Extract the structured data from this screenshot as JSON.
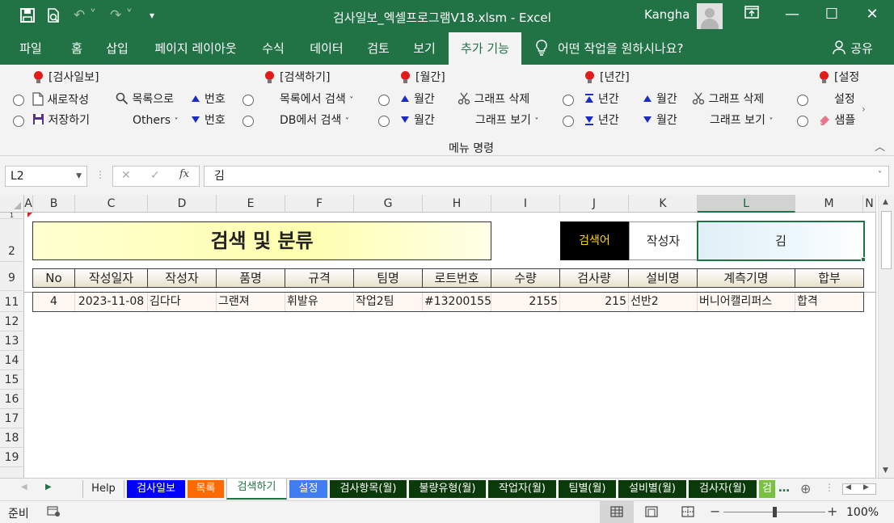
{
  "titlebar": {
    "doc_title": "검사일보_엑셀프로그램V18.xlsm  -  Excel",
    "user": "Kangha",
    "customize_glyph": "▾"
  },
  "ribbon_tabs": [
    {
      "label": "파일"
    },
    {
      "label": "홈"
    },
    {
      "label": "삽입"
    },
    {
      "label": "페이지 레이아웃"
    },
    {
      "label": "수식"
    },
    {
      "label": "데이터"
    },
    {
      "label": "검토"
    },
    {
      "label": "보기"
    },
    {
      "label": "추가 기능"
    }
  ],
  "tell_me": "어떤 작업을 원하시나요?",
  "share": "공유",
  "ribbon": {
    "groups": {
      "daily": "[검사일보]",
      "search": "[검색하기]",
      "monthly": "[월간]",
      "yearly": "[년간]",
      "settings": "[설정"
    },
    "new_doc": "새로작성",
    "save": "저장하기",
    "to_list": "목록으로",
    "others": "Others",
    "num_up": "번호",
    "num_down": "번호",
    "search_list": "목록에서 검색",
    "search_db": "DB에서 검색",
    "month_up": "월간",
    "month_down": "월간",
    "graph_delete": "그래프 삭제",
    "graph_view": "그래프 보기",
    "year_up": "년간",
    "year_down": "년간",
    "month2_up": "월간",
    "month2_down": "월간",
    "graph2_delete": "그래프 삭제",
    "graph2_view": "그래프 보기",
    "settings_btn": "설정",
    "sample_btn": "샘플",
    "group_caption": "메뉴 명령"
  },
  "formula": {
    "cell_ref": "L2",
    "value": "김"
  },
  "columns": [
    "A",
    "B",
    "C",
    "D",
    "E",
    "F",
    "G",
    "H",
    "I",
    "J",
    "K",
    "L",
    "M",
    "N"
  ],
  "sheet": {
    "title": "검색 및 분류",
    "search_label": "검색어",
    "search_field": "작성자",
    "search_value": "김",
    "headers": [
      "No",
      "작성일자",
      "작성자",
      "품명",
      "규격",
      "팀명",
      "로트번호",
      "수량",
      "검사량",
      "설비명",
      "계측기명",
      "합부"
    ],
    "row": [
      "4",
      "2023-11-08",
      "김다다",
      "그랜져",
      "휘발유",
      "작업2팀",
      "#13200155",
      "2155",
      "215",
      "선반2",
      "버니어캘리퍼스",
      "합격"
    ]
  },
  "row_numbers": [
    "1",
    "2",
    "9",
    "11",
    "12",
    "13",
    "14",
    "15",
    "16",
    "17",
    "18",
    "19"
  ],
  "sheet_tabs": [
    {
      "label": "Help",
      "bg": "#f3f3f3",
      "fg": "#222"
    },
    {
      "label": "검사일보",
      "bg": "#0000ff",
      "fg": "#ffffff"
    },
    {
      "label": "목록",
      "bg": "#ff6a00",
      "fg": "#ffffff"
    },
    {
      "label": "검색하기",
      "bg": "#ffffff",
      "fg": "#217346"
    },
    {
      "label": "설정",
      "bg": "#3f7df0",
      "fg": "#ffffff"
    },
    {
      "label": "검사항목(월)",
      "bg": "#0a3a0a",
      "fg": "#ffffff"
    },
    {
      "label": "불량유형(월)",
      "bg": "#0a3a0a",
      "fg": "#ffffff"
    },
    {
      "label": "작업자(월)",
      "bg": "#0a3a0a",
      "fg": "#ffffff"
    },
    {
      "label": "팀별(월)",
      "bg": "#0a3a0a",
      "fg": "#ffffff"
    },
    {
      "label": "설비별(월)",
      "bg": "#0a3a0a",
      "fg": "#ffffff"
    },
    {
      "label": "검사자(월)",
      "bg": "#0a3a0a",
      "fg": "#ffffff"
    },
    {
      "label": "검",
      "bg": "#7ac142",
      "fg": "#ffffff"
    }
  ],
  "status": {
    "mode": "준비",
    "zoom": "100%",
    "zoom_level": 1.0
  },
  "colors": {
    "excel_green": "#217346",
    "title_yellow": "#ffffc0",
    "search_label_bg": "#000000",
    "search_label_fg": "#ffd700",
    "result_row_bg": "#fff5f0"
  }
}
